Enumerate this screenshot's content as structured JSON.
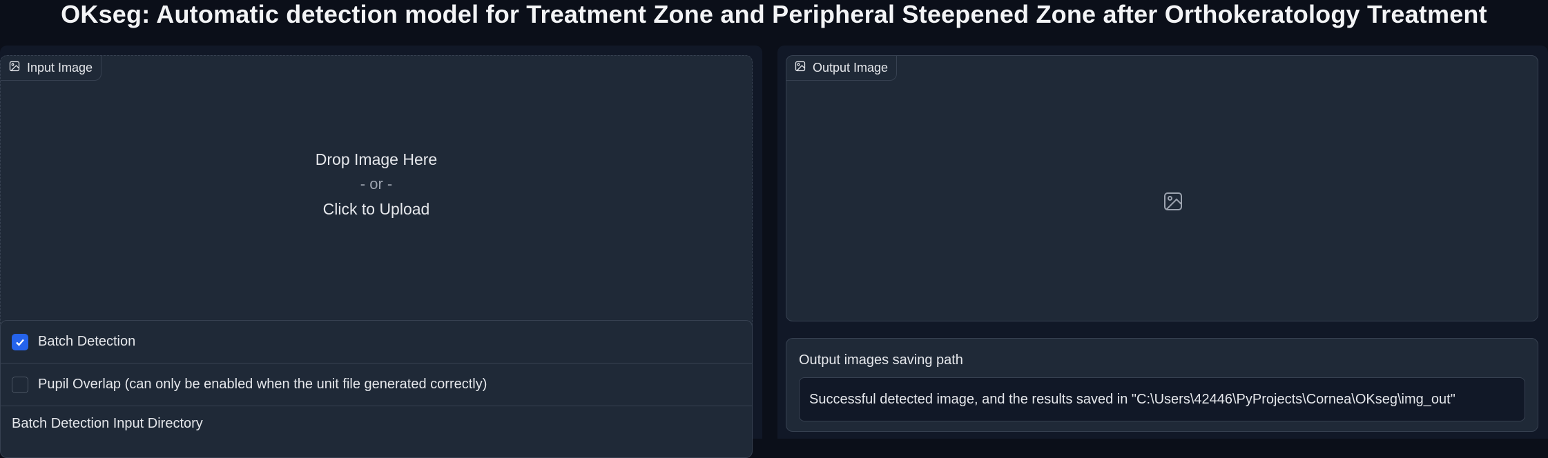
{
  "app": {
    "title": "OKseg: Automatic detection model for Treatment Zone and Peripheral Steepened Zone after Orthokeratology Treatment"
  },
  "input_image": {
    "label": "Input Image",
    "icon": "image-icon",
    "drop_text": "Drop Image Here",
    "or_text": "- or -",
    "upload_text": "Click to Upload"
  },
  "options": {
    "batch_detection": {
      "label": "Batch Detection",
      "checked": true
    },
    "pupil_overlap": {
      "label": "Pupil Overlap (can only be enabled when the unit file generated correctly)",
      "checked": false
    },
    "batch_input_dir_label": "Batch Detection Input Directory"
  },
  "output_image": {
    "label": "Output Image",
    "icon": "image-icon",
    "placeholder_icon": "image-placeholder-icon"
  },
  "output_path": {
    "label": "Output images saving path",
    "value": "Successful detected image, and the results saved in \"C:\\Users\\42446\\PyProjects\\Cornea\\OKseg\\img_out\""
  },
  "colors": {
    "background": "#0b0f19",
    "panel": "#1f2937",
    "border": "#374151",
    "accent": "#2563eb"
  }
}
